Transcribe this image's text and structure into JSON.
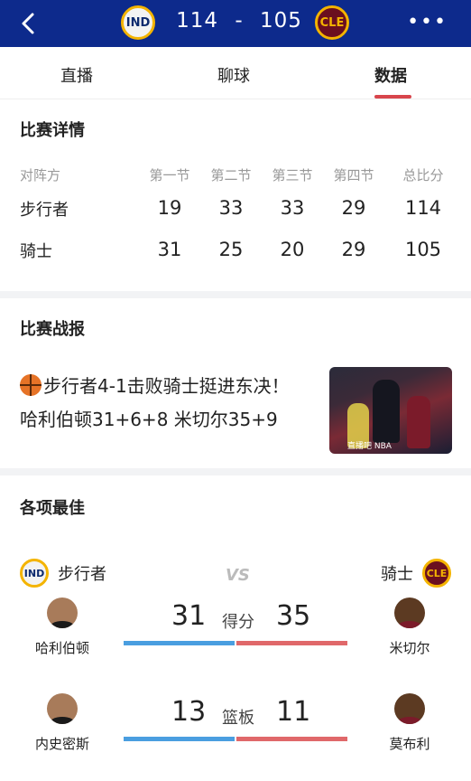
{
  "header": {
    "home_abbr": "IND",
    "away_abbr": "CLE",
    "home_score": "114",
    "separator": "-",
    "away_score": "105",
    "back_icon": "back-chevron-icon",
    "more_icon": "more-dots-icon",
    "colors": {
      "bar": "#0d2a8c"
    }
  },
  "tabs": [
    {
      "label": "直播"
    },
    {
      "label": "聊球"
    },
    {
      "label": "数据",
      "active": true
    }
  ],
  "details": {
    "title": "比赛详情",
    "headers": [
      "对阵方",
      "第一节",
      "第二节",
      "第三节",
      "第四节",
      "总比分"
    ],
    "rows": [
      {
        "team": "步行者",
        "q": [
          "19",
          "33",
          "33",
          "29",
          "114"
        ]
      },
      {
        "team": "骑士",
        "q": [
          "31",
          "25",
          "20",
          "29",
          "105"
        ]
      }
    ]
  },
  "report": {
    "title": "比赛战报",
    "text": "步行者4-1击败骑士挺进东决！哈利伯顿31+6+8 米切尔35+9",
    "image_caption": "直播吧 NBA"
  },
  "best": {
    "title": "各项最佳",
    "home_team": "步行者",
    "away_team": "骑士",
    "vs": "VS",
    "stats": [
      {
        "label": "得分",
        "home_player": "哈利伯顿",
        "home_value": "31",
        "away_player": "米切尔",
        "away_value": "35"
      },
      {
        "label": "篮板",
        "home_player": "内史密斯",
        "home_value": "13",
        "away_player": "莫布利",
        "away_value": "11"
      }
    ],
    "colors": {
      "home": "#4a9ee0",
      "away": "#e0686a"
    }
  }
}
